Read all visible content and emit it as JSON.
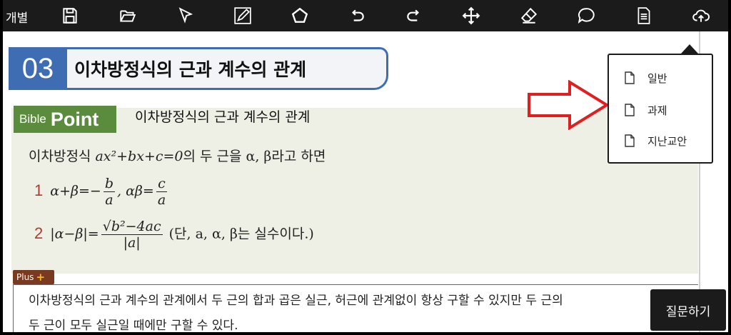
{
  "toolbar": {
    "mode_label": "개별",
    "icons": [
      "save-icon",
      "folder-open-icon",
      "pointer-icon",
      "pencil-icon",
      "pentagon-icon",
      "undo-icon",
      "redo-icon",
      "move-icon",
      "eraser-icon",
      "comment-icon",
      "document-icon",
      "cloud-upload-icon"
    ]
  },
  "section": {
    "number": "03",
    "title": "이차방정식의 근과 계수의 관계"
  },
  "bible_point": {
    "tab_small": "Bible",
    "tab_big": "Point",
    "title": "이차방정식의 근과 계수의 관계"
  },
  "math": {
    "intro_text": "이차방정식 ",
    "intro_expr": "ax²+bx+c=0",
    "intro_suffix": "의 두 근을 α, β라고 하면",
    "item1_num": "1",
    "item1_a": "α+β=−",
    "item1_frac1_num": "b",
    "item1_frac1_den": "a",
    "item1_b": ", αβ=",
    "item1_frac2_num": "c",
    "item1_frac2_den": "a",
    "item2_num": "2",
    "item2_a": "|α−β|=",
    "item2_frac_num": "√b²−4ac",
    "item2_frac_den": "|a|",
    "item2_note": " (단, a, α, β는 실수이다.)"
  },
  "plus": {
    "tag": "Plus",
    "tag_symbol": "+",
    "line1": "이차방정식의 근과 계수의 관계에서 두 근의 합과 곱은 실근, 허근에 관계없이 항상 구할 수 있지만 두 근의",
    "line2": "두 근이 모두 실근일 때에만 구할 수 있다."
  },
  "dropdown": {
    "items": [
      "일반",
      "과제",
      "지난교안"
    ]
  },
  "ask_button": "질문하기",
  "colors": {
    "toolbar": "#1b1b1b",
    "section_blue": "#3f6db3",
    "point_green": "#5b8b3c",
    "box_bg": "#eef0e6",
    "plus_brown": "#7a3a22",
    "arrow_red": "#e02020"
  }
}
